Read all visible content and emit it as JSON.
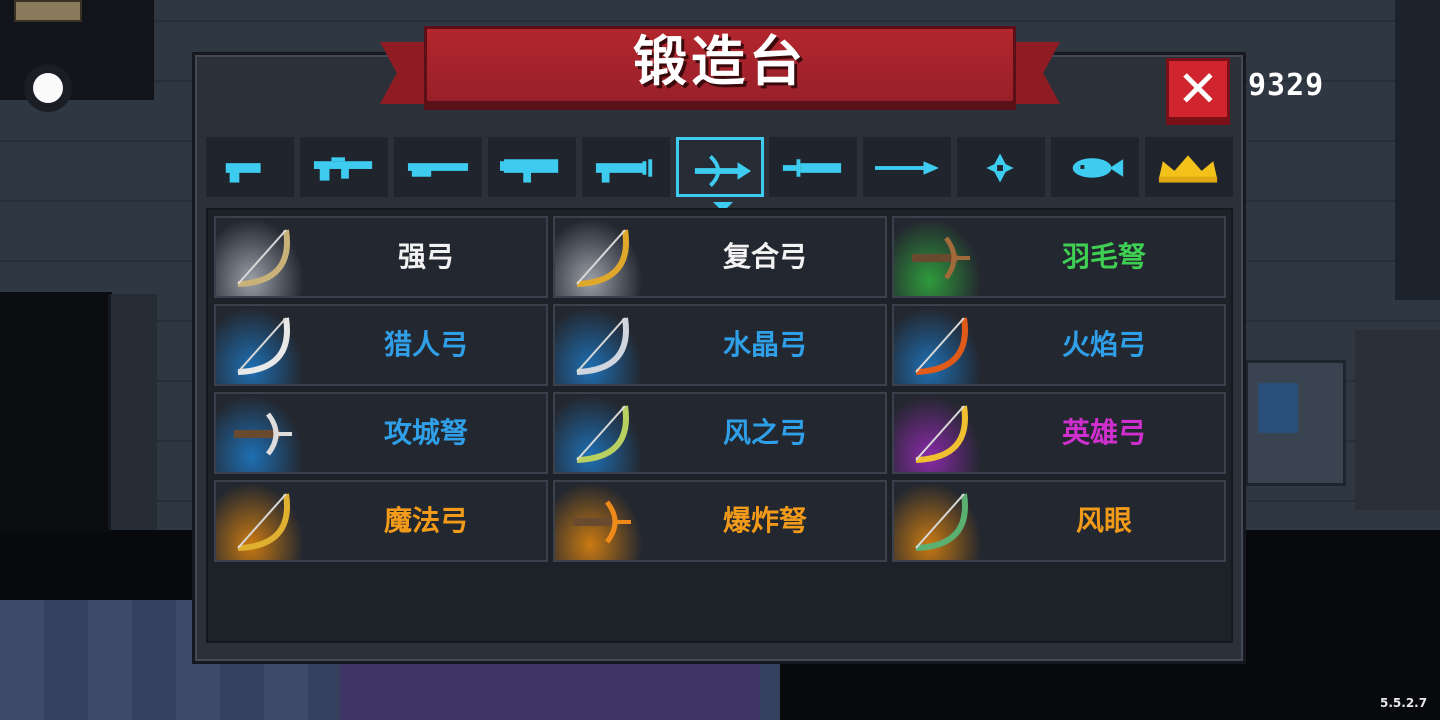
{
  "header": {
    "title": "锻造台",
    "close_label": "✕"
  },
  "hud": {
    "coins": "9329",
    "version": "5.5.2.7"
  },
  "tabs": {
    "active_index": 5,
    "items": [
      {
        "name": "pistol-icon"
      },
      {
        "name": "rifle-icon"
      },
      {
        "name": "shotgun-icon"
      },
      {
        "name": "launcher-icon"
      },
      {
        "name": "laser-gun-icon"
      },
      {
        "name": "bow-icon"
      },
      {
        "name": "sword-icon"
      },
      {
        "name": "spear-icon"
      },
      {
        "name": "shuriken-icon"
      },
      {
        "name": "fish-icon"
      },
      {
        "name": "crown-icon"
      }
    ]
  },
  "colors": {
    "white": "#f2f2f2",
    "green": "#3fcf52",
    "blue": "#2f9fe8",
    "purple": "#d02fcf",
    "orange": "#f29a1a",
    "accent": "#3ecbf0"
  },
  "weapons": [
    {
      "name": "强弓",
      "rarity": "white"
    },
    {
      "name": "复合弓",
      "rarity": "white"
    },
    {
      "name": "羽毛弩",
      "rarity": "green"
    },
    {
      "name": "猎人弓",
      "rarity": "blue"
    },
    {
      "name": "水晶弓",
      "rarity": "blue"
    },
    {
      "name": "火焰弓",
      "rarity": "blue"
    },
    {
      "name": "攻城弩",
      "rarity": "blue"
    },
    {
      "name": "风之弓",
      "rarity": "blue"
    },
    {
      "name": "英雄弓",
      "rarity": "purple"
    },
    {
      "name": "魔法弓",
      "rarity": "orange"
    },
    {
      "name": "爆炸弩",
      "rarity": "orange"
    },
    {
      "name": "风眼",
      "rarity": "orange"
    }
  ]
}
